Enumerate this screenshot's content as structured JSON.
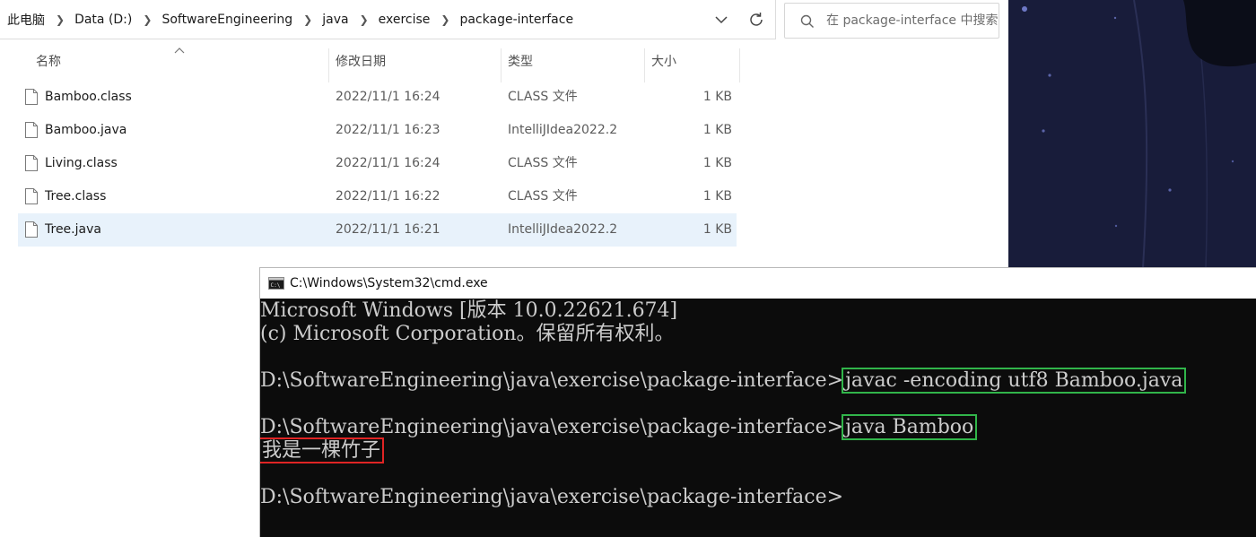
{
  "explorer": {
    "breadcrumb": [
      "此电脑",
      "Data (D:)",
      "SoftwareEngineering",
      "java",
      "exercise",
      "package-interface"
    ],
    "search_placeholder": "在 package-interface 中搜索",
    "columns": {
      "name": "名称",
      "modified": "修改日期",
      "type": "类型",
      "size": "大小"
    },
    "files": [
      {
        "name": "Bamboo.class",
        "modified": "2022/11/1 16:24",
        "type": "CLASS 文件",
        "size": "1 KB",
        "selected": false
      },
      {
        "name": "Bamboo.java",
        "modified": "2022/11/1 16:23",
        "type": "IntelliJIdea2022.2",
        "size": "1 KB",
        "selected": false
      },
      {
        "name": "Living.class",
        "modified": "2022/11/1 16:24",
        "type": "CLASS 文件",
        "size": "1 KB",
        "selected": false
      },
      {
        "name": "Tree.class",
        "modified": "2022/11/1 16:22",
        "type": "CLASS 文件",
        "size": "1 KB",
        "selected": false
      },
      {
        "name": "Tree.java",
        "modified": "2022/11/1 16:21",
        "type": "IntelliJIdea2022.2",
        "size": "1 KB",
        "selected": true
      }
    ],
    "selection_color": "#e8f2fb"
  },
  "cmd": {
    "title": "C:\\Windows\\System32\\cmd.exe",
    "banner1": "Microsoft Windows [版本 10.0.22621.674]",
    "banner2": "(c) Microsoft Corporation。保留所有权利。",
    "prompt": "D:\\SoftwareEngineering\\java\\exercise\\package-interface>",
    "command1": "javac -encoding utf8 Bamboo.java",
    "command2": "java Bamboo",
    "output": "我是一棵竹子",
    "highlight_command_color": "#31b54a",
    "highlight_output_color": "#e02424"
  }
}
